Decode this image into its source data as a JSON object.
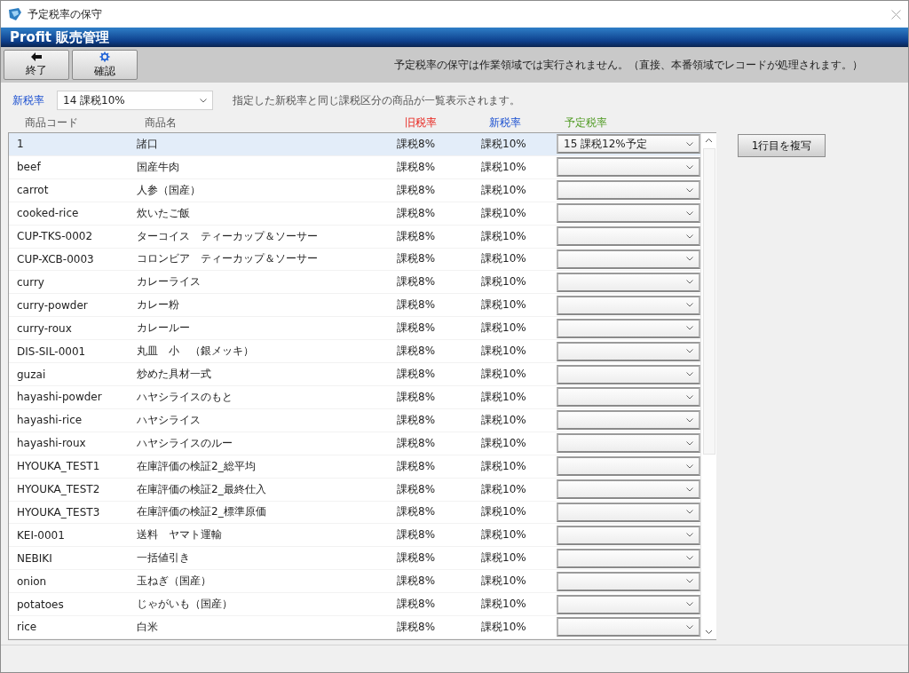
{
  "window": {
    "title": "予定税率の保守"
  },
  "app_header": {
    "title": "Profit 販売管理"
  },
  "toolbar": {
    "buttons": [
      {
        "label": "終了",
        "kind": "back"
      },
      {
        "label": "確認",
        "kind": "settings"
      }
    ],
    "notice": "予定税率の保守は作業領域では実行されません。（直接、本番領域でレコードが処理されます。）"
  },
  "filter": {
    "label": "新税率",
    "value": "14 課税10%",
    "hint": "指定した新税率と同じ課税区分の商品が一覧表示されます。"
  },
  "table": {
    "columns": [
      {
        "label": "商品コード",
        "kind": "plain"
      },
      {
        "label": "商品名",
        "kind": "plain"
      },
      {
        "label": "旧税率",
        "kind": "old"
      },
      {
        "label": "新税率",
        "kind": "new"
      },
      {
        "label": "予定税率",
        "kind": "scheduled"
      }
    ],
    "rows": [
      {
        "code": "1",
        "name": "諸口",
        "old_rate": "課税8%",
        "new_rate": "課税10%",
        "scheduled_rate": "15 課税12%予定",
        "selected": true
      },
      {
        "code": "beef",
        "name": "国産牛肉",
        "old_rate": "課税8%",
        "new_rate": "課税10%",
        "selected": false
      },
      {
        "code": "carrot",
        "name": "人参（国産）",
        "old_rate": "課税8%",
        "new_rate": "課税10%",
        "selected": false
      },
      {
        "code": "cooked-rice",
        "name": "炊いたご飯",
        "old_rate": "課税8%",
        "new_rate": "課税10%",
        "selected": false
      },
      {
        "code": "CUP-TKS-0002",
        "name": "ターコイス　ティーカップ＆ソーサー",
        "old_rate": "課税8%",
        "new_rate": "課税10%",
        "selected": false
      },
      {
        "code": "CUP-XCB-0003",
        "name": "コロンビア　ティーカップ＆ソーサー",
        "old_rate": "課税8%",
        "new_rate": "課税10%",
        "selected": false
      },
      {
        "code": "curry",
        "name": "カレーライス",
        "old_rate": "課税8%",
        "new_rate": "課税10%",
        "selected": false
      },
      {
        "code": "curry-powder",
        "name": "カレー粉",
        "old_rate": "課税8%",
        "new_rate": "課税10%",
        "selected": false
      },
      {
        "code": "curry-roux",
        "name": "カレールー",
        "old_rate": "課税8%",
        "new_rate": "課税10%",
        "selected": false
      },
      {
        "code": "DIS-SIL-0001",
        "name": "丸皿　小　（銀メッキ）",
        "old_rate": "課税8%",
        "new_rate": "課税10%",
        "selected": false
      },
      {
        "code": "guzai",
        "name": "炒めた具材一式",
        "old_rate": "課税8%",
        "new_rate": "課税10%",
        "selected": false
      },
      {
        "code": "hayashi-powder",
        "name": "ハヤシライスのもと",
        "old_rate": "課税8%",
        "new_rate": "課税10%",
        "selected": false
      },
      {
        "code": "hayashi-rice",
        "name": "ハヤシライス",
        "old_rate": "課税8%",
        "new_rate": "課税10%",
        "selected": false
      },
      {
        "code": "hayashi-roux",
        "name": "ハヤシライスのルー",
        "old_rate": "課税8%",
        "new_rate": "課税10%",
        "selected": false
      },
      {
        "code": "HYOUKA_TEST1",
        "name": "在庫評価の検証2_総平均",
        "old_rate": "課税8%",
        "new_rate": "課税10%",
        "selected": false
      },
      {
        "code": "HYOUKA_TEST2",
        "name": "在庫評価の検証2_最終仕入",
        "old_rate": "課税8%",
        "new_rate": "課税10%",
        "selected": false
      },
      {
        "code": "HYOUKA_TEST3",
        "name": "在庫評価の検証2_標準原価",
        "old_rate": "課税8%",
        "new_rate": "課税10%",
        "selected": false
      },
      {
        "code": "KEI-0001",
        "name": "送料　ヤマト運輸",
        "old_rate": "課税8%",
        "new_rate": "課税10%",
        "selected": false
      },
      {
        "code": "NEBIKI",
        "name": "一括値引き",
        "old_rate": "課税8%",
        "new_rate": "課税10%",
        "selected": false
      },
      {
        "code": "onion",
        "name": "玉ねぎ（国産）",
        "old_rate": "課税8%",
        "new_rate": "課税10%",
        "selected": false
      },
      {
        "code": "potatoes",
        "name": "じゃがいも（国産）",
        "old_rate": "課税8%",
        "new_rate": "課税10%",
        "selected": false
      },
      {
        "code": "rice",
        "name": "白米",
        "old_rate": "課税8%",
        "new_rate": "課税10%",
        "selected": false
      }
    ]
  },
  "side_button": {
    "label": "1行目を複写"
  }
}
